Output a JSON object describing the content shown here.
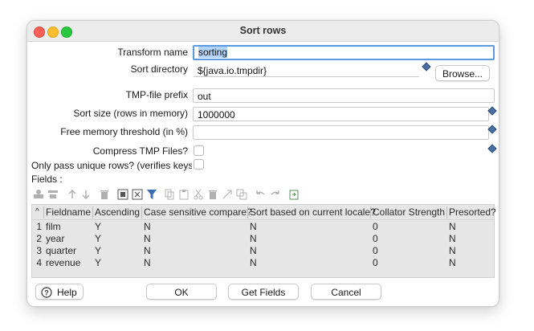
{
  "window": {
    "title": "Sort rows"
  },
  "form": {
    "transform_name_label": "Transform name",
    "transform_name_value": "sorting",
    "sort_directory_label": "Sort directory",
    "sort_directory_value": "${java.io.tmpdir}",
    "browse_label": "Browse...",
    "tmp_prefix_label": "TMP-file prefix",
    "tmp_prefix_value": "out",
    "sort_size_label": "Sort size (rows in memory)",
    "sort_size_value": "1000000",
    "free_memory_label": "Free memory threshold (in %)",
    "free_memory_value": "",
    "compress_label": "Compress TMP Files?",
    "unique_label": "Only pass unique rows? (verifies keys or",
    "fields_label": "Fields :"
  },
  "grid": {
    "sort_indicator": "^",
    "headers": [
      "Fieldname",
      "Ascending",
      "Case sensitive compare?",
      "Sort based on current locale?",
      "Collator Strength",
      "Presorted?"
    ],
    "rows": [
      {
        "num": "1",
        "fieldname": "film",
        "ascending": "Y",
        "case": "N",
        "locale": "N",
        "collator": "0",
        "presorted": "N"
      },
      {
        "num": "2",
        "fieldname": "year",
        "ascending": "Y",
        "case": "N",
        "locale": "N",
        "collator": "0",
        "presorted": "N"
      },
      {
        "num": "3",
        "fieldname": "quarter",
        "ascending": "Y",
        "case": "N",
        "locale": "N",
        "collator": "0",
        "presorted": "N"
      },
      {
        "num": "4",
        "fieldname": "revenue",
        "ascending": "Y",
        "case": "N",
        "locale": "N",
        "collator": "0",
        "presorted": "N"
      }
    ]
  },
  "buttons": {
    "help": "Help",
    "ok": "OK",
    "get_fields": "Get Fields",
    "cancel": "Cancel"
  },
  "toolbar_icons": [
    "insert-row-icon",
    "delete-row-icon",
    "move-up-icon",
    "move-down-icon",
    "trash-icon",
    "select-all-icon",
    "clear-selection-icon",
    "filter-icon",
    "copy-icon",
    "paste-icon",
    "cut-icon",
    "delete-icon",
    "collapse-icon",
    "copy-paste-icon",
    "undo-icon",
    "redo-icon",
    "export-icon"
  ]
}
